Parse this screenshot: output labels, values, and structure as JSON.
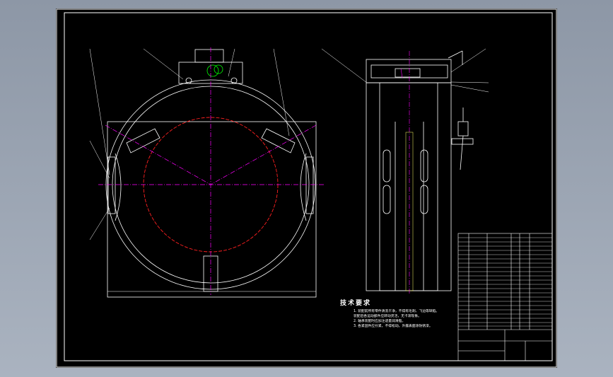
{
  "window": {
    "title": ""
  },
  "drawing": {
    "tech_title": "技术要求",
    "tech_notes": [
      "1. 装配前所有零件清洗干净，不得有毛刺、飞边等缺陷。",
      "   装配后各运动部件应转动灵活，无卡滞现象。",
      "2. 轴承装配时应加注适量润滑脂。",
      "3. 各紧固件应拧紧，不得松动。外露表面涂防锈漆。"
    ],
    "colors": {
      "line": "#ffffff",
      "centerline": "#ff00ff",
      "red_circle": "#ff2020",
      "green": "#00ff00",
      "frame": "#ffffff",
      "sheet": "#000000"
    }
  }
}
